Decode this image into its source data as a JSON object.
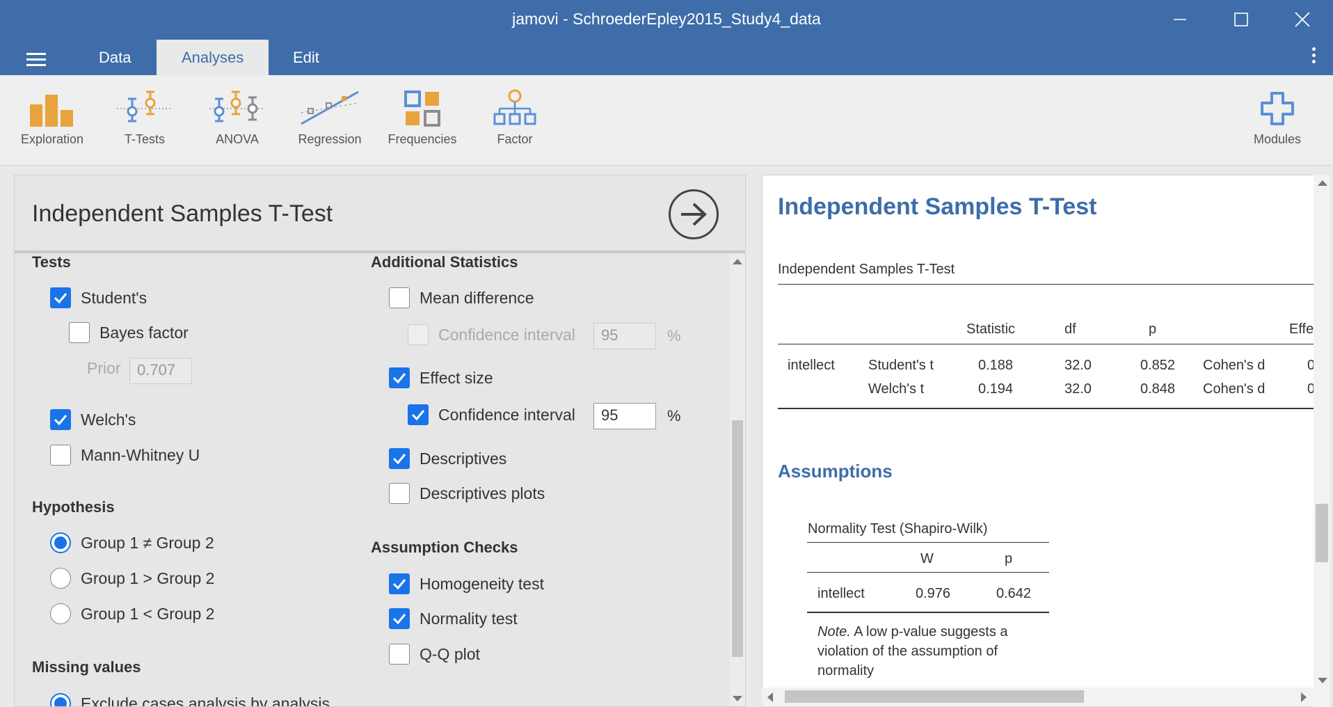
{
  "window": {
    "title": "jamovi - SchroederEpley2015_Study4_data"
  },
  "menu": {
    "tabs": [
      {
        "label": "Data"
      },
      {
        "label": "Analyses"
      },
      {
        "label": "Edit"
      }
    ]
  },
  "ribbon": {
    "items": [
      {
        "label": "Exploration",
        "icon": "exploration-icon"
      },
      {
        "label": "T-Tests",
        "icon": "t-tests-icon"
      },
      {
        "label": "ANOVA",
        "icon": "anova-icon"
      },
      {
        "label": "Regression",
        "icon": "regression-icon"
      },
      {
        "label": "Frequencies",
        "icon": "frequencies-icon"
      },
      {
        "label": "Factor",
        "icon": "factor-icon"
      }
    ],
    "modules": {
      "label": "Modules"
    },
    "colors": {
      "accent": "#3e6da9",
      "orange": "#e8a33d",
      "blue": "#5a8fd6",
      "grey": "#8c8c8c"
    }
  },
  "options": {
    "title": "Independent Samples T-Test",
    "tests": {
      "heading": "Tests",
      "students": {
        "label": "Student's",
        "checked": true
      },
      "bayes": {
        "label": "Bayes factor",
        "checked": false
      },
      "prior": {
        "label": "Prior",
        "value": "0.707"
      },
      "welchs": {
        "label": "Welch's",
        "checked": true
      },
      "mann": {
        "label": "Mann-Whitney U",
        "checked": false
      }
    },
    "hypothesis": {
      "heading": "Hypothesis",
      "options": [
        {
          "label": "Group 1 ≠ Group 2",
          "selected": true
        },
        {
          "label": "Group 1 > Group 2",
          "selected": false
        },
        {
          "label": "Group 1 < Group 2",
          "selected": false
        }
      ]
    },
    "missing": {
      "heading": "Missing values",
      "option": "Exclude cases analysis by analysis"
    },
    "additional": {
      "heading": "Additional Statistics",
      "mean_diff": {
        "label": "Mean difference",
        "checked": false
      },
      "md_ci": {
        "label": "Confidence interval",
        "value": "95",
        "unit": "%"
      },
      "effect_size": {
        "label": "Effect size",
        "checked": true
      },
      "es_ci": {
        "label": "Confidence interval",
        "value": "95",
        "unit": "%",
        "checked": true
      },
      "descriptives": {
        "label": "Descriptives",
        "checked": true
      },
      "desc_plots": {
        "label": "Descriptives plots",
        "checked": false
      }
    },
    "assumptions": {
      "heading": "Assumption Checks",
      "homogeneity": {
        "label": "Homogeneity test",
        "checked": true
      },
      "normality": {
        "label": "Normality test",
        "checked": true
      },
      "qq": {
        "label": "Q-Q plot",
        "checked": false
      }
    }
  },
  "results": {
    "title": "Independent Samples T-Test",
    "table_title": "Independent Samples T-Test",
    "columns": [
      "Statistic",
      "df",
      "p",
      "Effe"
    ],
    "rows": [
      {
        "var": "intellect",
        "test": "Student's t",
        "statistic": "0.188",
        "df": "32.0",
        "p": "0.852",
        "effect": "Cohen's d",
        "es_value": "0"
      },
      {
        "var": "",
        "test": "Welch's t",
        "statistic": "0.194",
        "df": "32.0",
        "p": "0.848",
        "effect": "Cohen's d",
        "es_value": "0"
      }
    ],
    "assumptions_heading": "Assumptions",
    "normality": {
      "title": "Normality Test (Shapiro-Wilk)",
      "columns": [
        "W",
        "p"
      ],
      "row": {
        "var": "intellect",
        "W": "0.976",
        "p": "0.642"
      },
      "note_label": "Note.",
      "note_text": "A low p-value suggests a violation of the assumption of normality"
    }
  }
}
